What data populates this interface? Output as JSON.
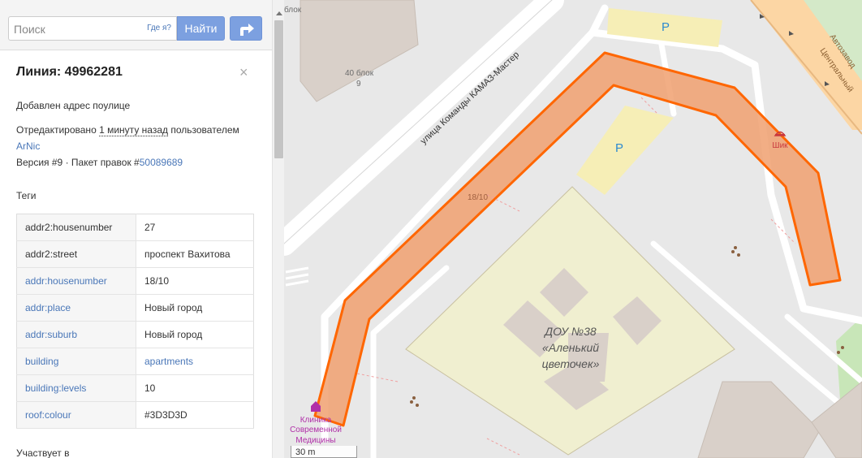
{
  "search": {
    "placeholder": "Поиск",
    "where_am_i": "Где я?",
    "button_label": "Найти"
  },
  "feature": {
    "title": "Линия: 49962281",
    "comment": "Добавлен адрес поулице",
    "edited_prefix": "Отредактировано",
    "edited_time": "1 минуту назад",
    "edited_suffix": "пользователем",
    "user": "ArNic",
    "version_prefix": "Версия #9 · Пакет правок #",
    "changeset": "50089689"
  },
  "tags": {
    "heading": "Теги",
    "rows": [
      {
        "key": "addr2:housenumber",
        "value": "27"
      },
      {
        "key": "addr2:street",
        "value": "проспект Вахитова"
      },
      {
        "key": "addr:housenumber",
        "value": "18/10"
      },
      {
        "key": "addr:place",
        "value": "Новый город"
      },
      {
        "key": "addr:suburb",
        "value": "Новый город"
      },
      {
        "key": "building",
        "value": "apartments"
      },
      {
        "key": "building:levels",
        "value": "10"
      },
      {
        "key": "roof:colour",
        "value": "#3D3D3D"
      }
    ]
  },
  "part_of_heading": "Участвует в",
  "map": {
    "labels": {
      "block_top": "блок",
      "block40_a": "40 блок",
      "block40_b": "9",
      "street": "улица Команды КАМАЗ-Мастер",
      "house_number": "18/10",
      "parking": "P",
      "kindergarten_1": "ДОУ №38",
      "kindergarten_2": "«Аленький",
      "kindergarten_3": "цветочек»",
      "shop": "Шик",
      "clinic_1": "Клиника",
      "clinic_2": "Современной",
      "clinic_3": "Медицины",
      "road_1": "Автозавод",
      "road_2": "Центральный"
    },
    "scale": "30 m",
    "colors": {
      "selection_stroke": "#ff6600",
      "selection_fill": "#f0a070",
      "building": "#d9d0c9",
      "school_area": "#f0efd0",
      "parking": "#f6eeb6",
      "road": "#ffffff",
      "main_road": "#fcd6a4"
    }
  }
}
